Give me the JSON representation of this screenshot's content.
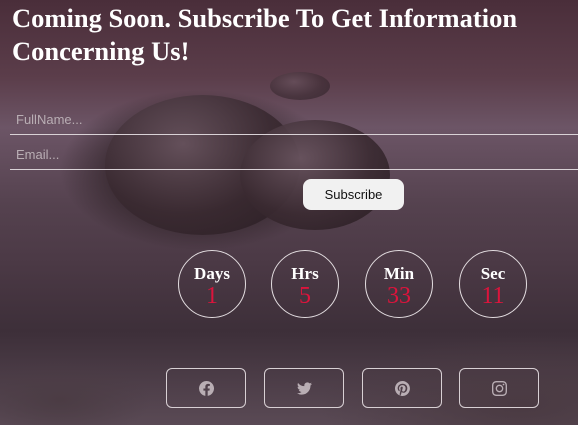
{
  "header": {
    "title": "Coming Soon. Subscribe To Get Information Concerning Us!"
  },
  "form": {
    "fullname_placeholder": "FullName...",
    "email_placeholder": "Email...",
    "subscribe_label": "Subscribe"
  },
  "countdown": {
    "days": {
      "label": "Days",
      "value": "1"
    },
    "hours": {
      "label": "Hrs",
      "value": "5"
    },
    "minutes": {
      "label": "Min",
      "value": "33"
    },
    "seconds": {
      "label": "Sec",
      "value": "11"
    }
  },
  "social": [
    "facebook-icon",
    "twitter-icon",
    "pinterest-icon",
    "instagram-icon"
  ],
  "colors": {
    "accent": "#dc143c",
    "text": "#ffffff",
    "button_bg": "#f1f1f1"
  }
}
